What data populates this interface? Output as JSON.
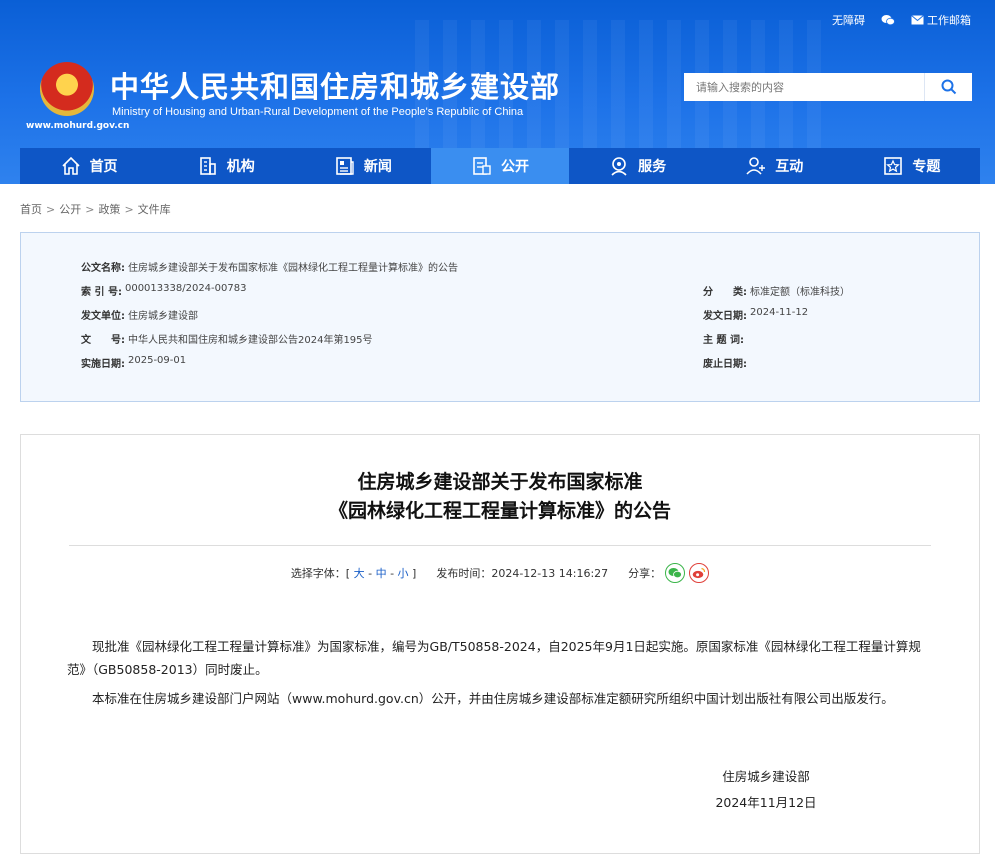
{
  "header": {
    "top_links": [
      {
        "label": "无障碍",
        "icon": "accessibility-icon"
      },
      {
        "label": "",
        "icon": "wechat-icon"
      },
      {
        "label": "工作邮箱",
        "icon": "mail-icon"
      }
    ],
    "site_name_cn": "中华人民共和国住房和城乡建设部",
    "site_name_en": "Ministry of Housing and Urban-Rural Development of the People's Republic of China",
    "site_url": "www.mohurd.gov.cn",
    "search": {
      "placeholder": "请输入搜索的内容",
      "value": ""
    }
  },
  "nav": [
    {
      "label": "首页",
      "icon": "home-icon",
      "active": false
    },
    {
      "label": "机构",
      "icon": "building-icon",
      "active": false
    },
    {
      "label": "新闻",
      "icon": "news-icon",
      "active": false
    },
    {
      "label": "公开",
      "icon": "document-icon",
      "active": true
    },
    {
      "label": "服务",
      "icon": "service-icon",
      "active": false
    },
    {
      "label": "互动",
      "icon": "interaction-icon",
      "active": false
    },
    {
      "label": "专题",
      "icon": "star-icon",
      "active": false
    }
  ],
  "breadcrumb": [
    "首页",
    "公开",
    "政策",
    "文件库"
  ],
  "meta": {
    "doc_name_label": "公文名称:",
    "doc_name": "住房城乡建设部关于发布国家标准《园林绿化工程工程量计算标准》的公告",
    "index_label": "索 引 号:",
    "index": "000013338/2024-00783",
    "category_label": "分　　类:",
    "category": "标准定额（标准科技）",
    "issuer_label": "发文单位:",
    "issuer": "住房城乡建设部",
    "issue_date_label": "发文日期:",
    "issue_date": "2024-11-12",
    "doc_no_label": "文　　号:",
    "doc_no": "中华人民共和国住房和城乡建设部公告2024年第195号",
    "subject_label": "主 题 词:",
    "subject": "",
    "effective_label": "实施日期:",
    "effective": "2025-09-01",
    "expire_label": "废止日期:",
    "expire": ""
  },
  "article": {
    "title_line1": "住房城乡建设部关于发布国家标准",
    "title_line2": "《园林绿化工程工程量计算标准》的公告",
    "font_label": "选择字体：[",
    "font_large": "大",
    "font_medium": "中",
    "font_small": "小",
    "font_close": "]",
    "publish_label": "发布时间：",
    "publish_time": "2024-12-13 14:16:27",
    "share_label": "分享：",
    "paragraphs": [
      "现批准《园林绿化工程工程量计算标准》为国家标准，编号为GB/T50858-2024，自2025年9月1日起实施。原国家标准《园林绿化工程工程量计算规范》（GB50858-2013）同时废止。",
      "本标准在住房城乡建设部门户网站（www.mohurd.gov.cn）公开，并由住房城乡建设部标准定额研究所组织中国计划出版社有限公司出版发行。"
    ],
    "signature": "住房城乡建设部",
    "signature_date": "2024年11月12日"
  },
  "colors": {
    "header_blue": "#1d72e8",
    "nav_blue": "#0e56c6",
    "nav_active": "#3a8ef0",
    "meta_bg": "#f3f8fe",
    "link_blue": "#1a5fc8"
  }
}
